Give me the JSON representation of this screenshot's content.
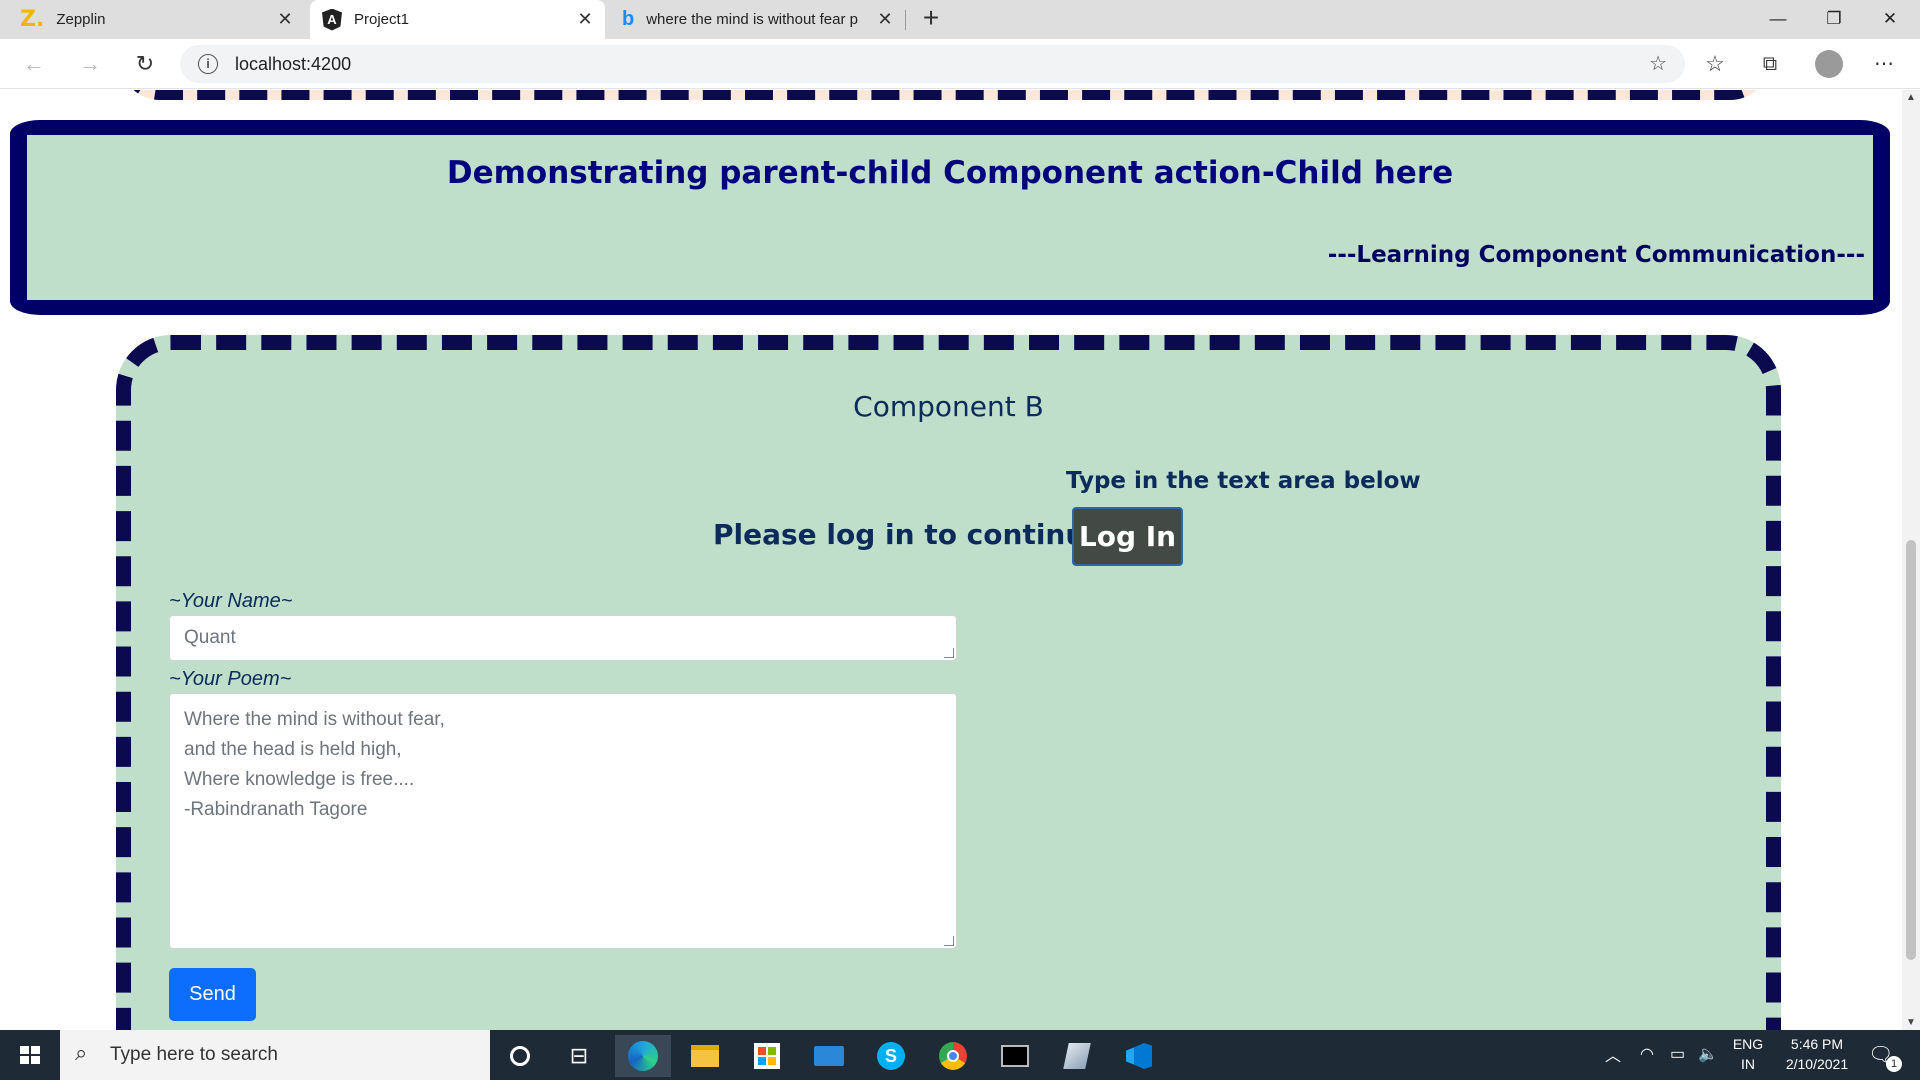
{
  "browser": {
    "tabs": [
      {
        "title": "Zepplin",
        "icon": "zeplin-logo-icon"
      },
      {
        "title": "Project1",
        "icon": "angular-logo-icon",
        "active": true
      },
      {
        "title": "where the mind is without fear p",
        "icon": "bing-logo-icon"
      }
    ],
    "new_tab_label": "+",
    "url": "localhost:4200"
  },
  "page": {
    "child_panel": {
      "title": "Demonstrating parent-child Component action-Child here",
      "subtitle": "---Learning Component Communication---"
    },
    "component_b": {
      "title": "Component B",
      "hint": "Type in the text area below",
      "login_message": "Please log in to continue!",
      "login_button": "Log In",
      "name_label": "~Your Name~",
      "name_value": "Quant",
      "poem_label": "~Your Poem~",
      "poem_value": "Where the mind is without fear,\nand the head is held high,\nWhere knowledge is free....\n-Rabindranath Tagore",
      "send_button": "Send"
    }
  },
  "taskbar": {
    "search_placeholder": "Type here to search",
    "language": "ENG",
    "region": "IN",
    "time": "5:46 PM",
    "date": "2/10/2021",
    "notification_count": "1"
  },
  "colors": {
    "panel_bg": "#bfdfca",
    "navy_border": "#000066",
    "title_blue": "#03037d",
    "send_blue": "#0d6efd",
    "login_gray": "#434a46"
  }
}
